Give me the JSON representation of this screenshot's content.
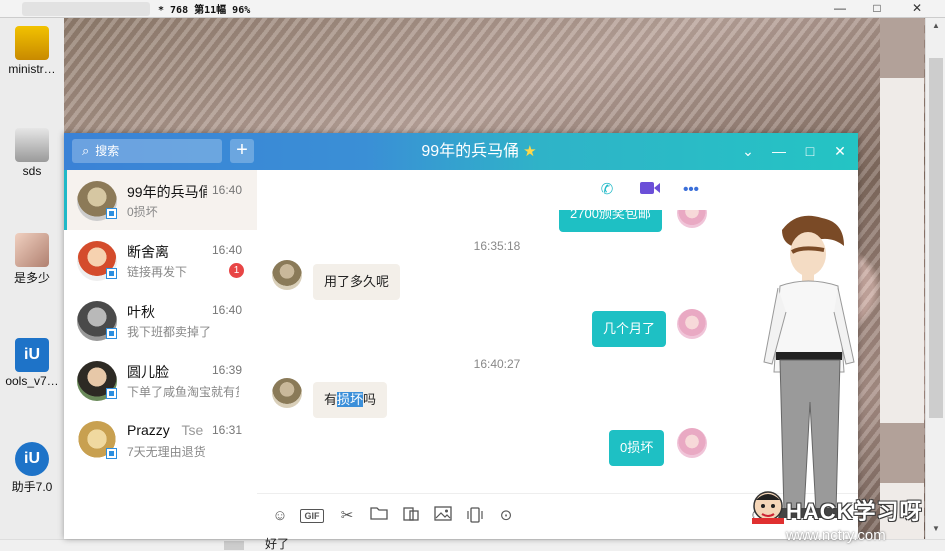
{
  "viewer": {
    "info": "* 768 第11幅 96%",
    "min_glyph": "—",
    "max_glyph": "□",
    "close_glyph": "✕",
    "scroll_up": "▲",
    "scroll_down": "▼"
  },
  "desktop_icons": [
    {
      "label": "ministr…"
    },
    {
      "label": "sds"
    },
    {
      "label": "是多少"
    },
    {
      "label": "ools_v7…"
    },
    {
      "label": "助手7.0"
    }
  ],
  "search": {
    "placeholder": "搜索"
  },
  "add_button": "+",
  "chat": {
    "title": "99年的兵马俑",
    "messages": [
      {
        "text": "2700颁奖包邮",
        "direction": "out"
      },
      {
        "type": "time",
        "text": "16:35:18"
      },
      {
        "text": "用了多久呢",
        "direction": "in"
      },
      {
        "text": "几个月了",
        "direction": "out"
      },
      {
        "type": "time",
        "text": "16:40:27"
      },
      {
        "text_before": "有",
        "text_highlight": "损坏",
        "text_after": "吗",
        "direction": "in"
      },
      {
        "text": "0损坏",
        "direction": "out"
      }
    ],
    "input_text": "好了"
  },
  "contacts": [
    {
      "name": "99年的兵马俑",
      "time": "16:40",
      "last_msg": "0损坏",
      "active": true,
      "unread": ""
    },
    {
      "name": "断舍离",
      "time": "16:40",
      "last_msg": "链接再发下",
      "active": false,
      "unread": "1"
    },
    {
      "name": "叶秋",
      "time": "16:40",
      "last_msg": "我下班都卖掉了",
      "active": false,
      "unread": ""
    },
    {
      "name": "圆儿脸",
      "time": "16:39",
      "last_msg": "下单了咸鱼淘宝就有货",
      "active": false,
      "unread": ""
    },
    {
      "name": "Prazzy",
      "name_extra": "Tse",
      "time": "16:31",
      "last_msg": "7天无理由退货",
      "active": false,
      "unread": ""
    }
  ],
  "watermark": {
    "brand": "HACK学习呀",
    "url": "www.nctry.com"
  },
  "colors": {
    "title_left": "#3a82d6",
    "title_right": "#24c4c4",
    "bubble_out": "#1ec0c4",
    "bubble_in": "#f3efe9",
    "badge": "#e84545",
    "highlight": "#3b8fd9"
  }
}
